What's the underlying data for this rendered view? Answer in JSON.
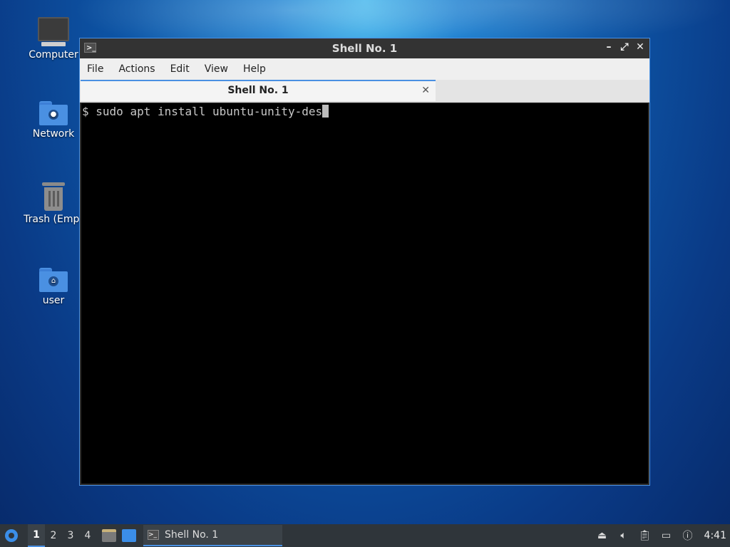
{
  "desktop": {
    "icons": [
      {
        "label": "Computer"
      },
      {
        "label": "Network"
      },
      {
        "label": "Trash (Empt"
      },
      {
        "label": "user"
      }
    ]
  },
  "window": {
    "title": "Shell No. 1",
    "menu": [
      "File",
      "Actions",
      "Edit",
      "View",
      "Help"
    ],
    "tab": {
      "label": "Shell No. 1"
    },
    "terminal": {
      "prompt": "$",
      "command": "sudo apt install ubuntu-unity-des"
    }
  },
  "taskbar": {
    "workspaces": [
      "1",
      "2",
      "3",
      "4"
    ],
    "active_workspace": "1",
    "task_label": "Shell No. 1",
    "clock": "4:41"
  },
  "colors": {
    "accent": "#4a90e2",
    "terminal_bg": "#000000",
    "taskbar_bg": "#2f353a"
  }
}
